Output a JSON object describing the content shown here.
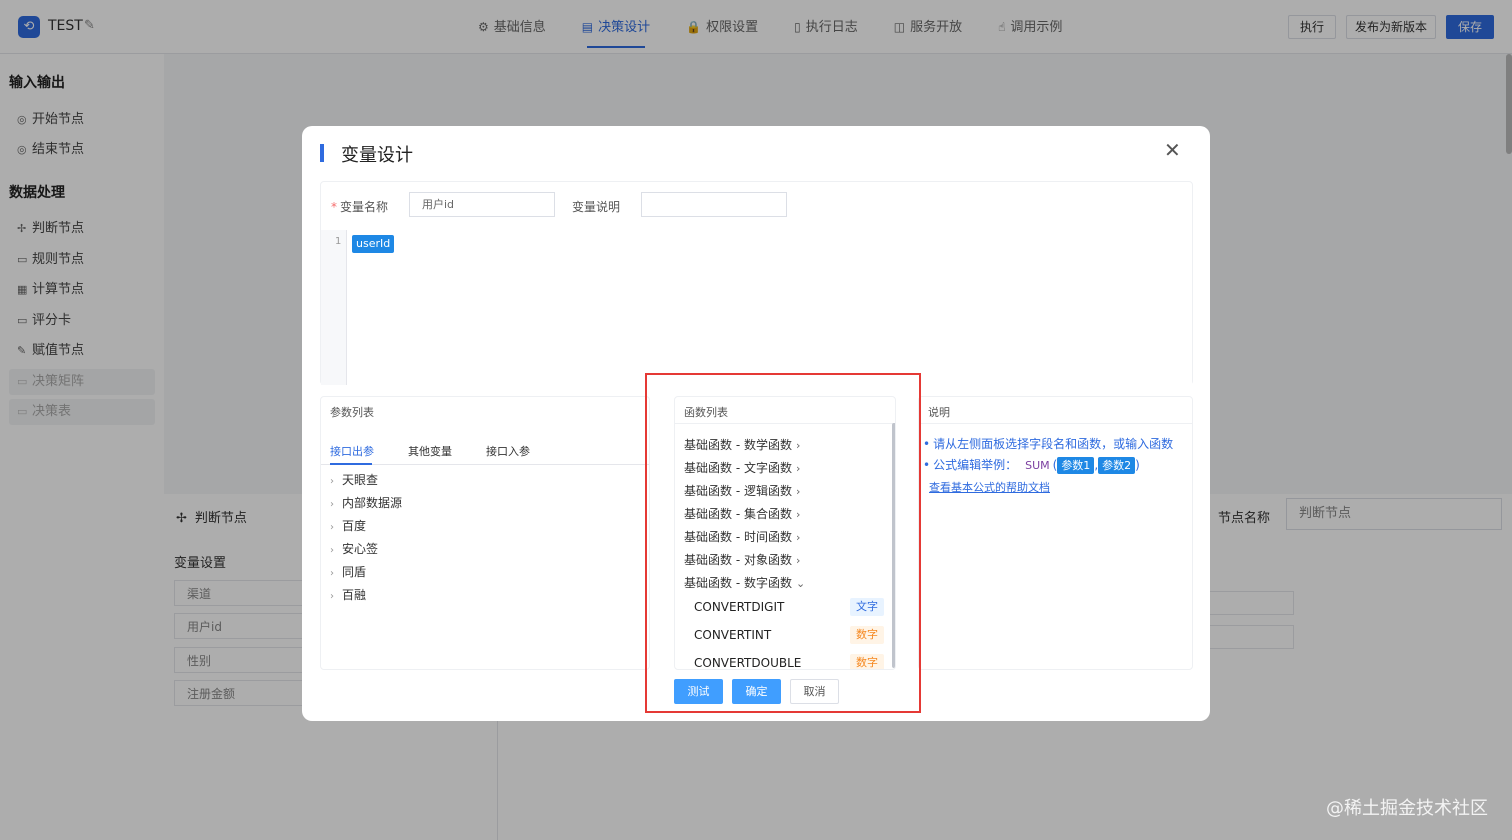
{
  "app": {
    "title": "TEST"
  },
  "nav": [
    {
      "label": "基础信息",
      "icon": "gear-icon",
      "glyph": "⚙"
    },
    {
      "label": "决策设计",
      "icon": "decision-icon",
      "glyph": "▤"
    },
    {
      "label": "权限设置",
      "icon": "lock-icon",
      "glyph": "🔒"
    },
    {
      "label": "执行日志",
      "icon": "log-icon",
      "glyph": "▯"
    },
    {
      "label": "服务开放",
      "icon": "service-icon",
      "glyph": "◫"
    },
    {
      "label": "调用示例",
      "icon": "example-icon",
      "glyph": "☝"
    }
  ],
  "toolbar": {
    "execute_label": "执行",
    "publish_label": "发布为新版本",
    "save_label": "保存"
  },
  "sidebar": {
    "io_title": "输入输出",
    "process_title": "数据处理",
    "items": [
      {
        "label": "开始节点",
        "glyph": "◎"
      },
      {
        "label": "结束节点",
        "glyph": "◎"
      },
      {
        "label": "判断节点",
        "glyph": "✢"
      },
      {
        "label": "规则节点",
        "glyph": "▭"
      },
      {
        "label": "计算节点",
        "glyph": "▦"
      },
      {
        "label": "评分卡",
        "glyph": "▭"
      },
      {
        "label": "赋值节点",
        "glyph": "✎"
      },
      {
        "label": "决策矩阵",
        "glyph": "▭"
      },
      {
        "label": "决策表",
        "glyph": "▭"
      }
    ]
  },
  "bottom_panel": {
    "title": "判断节点",
    "var_settings": "变量设置",
    "rows": [
      "渠道",
      "用户id",
      "性别",
      "注册金额"
    ],
    "node_name_label": "节点名称",
    "node_name_value": "判断节点"
  },
  "modal": {
    "title": "变量设计",
    "var_name_label": "变量名称",
    "var_name_value": "用户id",
    "var_desc_label": "变量说明",
    "var_desc_value": "",
    "editor": {
      "line": "1",
      "token": "userId"
    },
    "params": {
      "title": "参数列表",
      "tabs": [
        "接口出参",
        "其他变量",
        "接口入参"
      ],
      "tree": [
        "天眼查",
        "内部数据源",
        "百度",
        "安心签",
        "同盾",
        "百融"
      ]
    },
    "functions": {
      "title": "函数列表",
      "groups": [
        "基础函数 - 数学函数",
        "基础函数 - 文字函数",
        "基础函数 - 逻辑函数",
        "基础函数 - 集合函数",
        "基础函数 - 时间函数",
        "基础函数 - 对象函数",
        "基础函数 - 数字函数"
      ],
      "expanded": [
        {
          "name": "CONVERTDIGIT",
          "tag": "文字",
          "kind": "text"
        },
        {
          "name": "CONVERTINT",
          "tag": "数字",
          "kind": "num"
        },
        {
          "name": "CONVERTDOUBLE",
          "tag": "数字",
          "kind": "num"
        }
      ]
    },
    "desc": {
      "title": "说明",
      "line1": "请从左侧面板选择字段名和函数，或输入函数",
      "line2_prefix": "公式编辑举例：",
      "sum": "SUM",
      "open_paren": "(",
      "param1": "参数1",
      "comma": ",",
      "param2": "参数2",
      "close_paren": ")",
      "help_link": "查看基本公式的帮助文档"
    },
    "buttons": {
      "test": "测试",
      "confirm": "确定",
      "cancel": "取消"
    }
  },
  "watermark": "@稀土掘金技术社区"
}
